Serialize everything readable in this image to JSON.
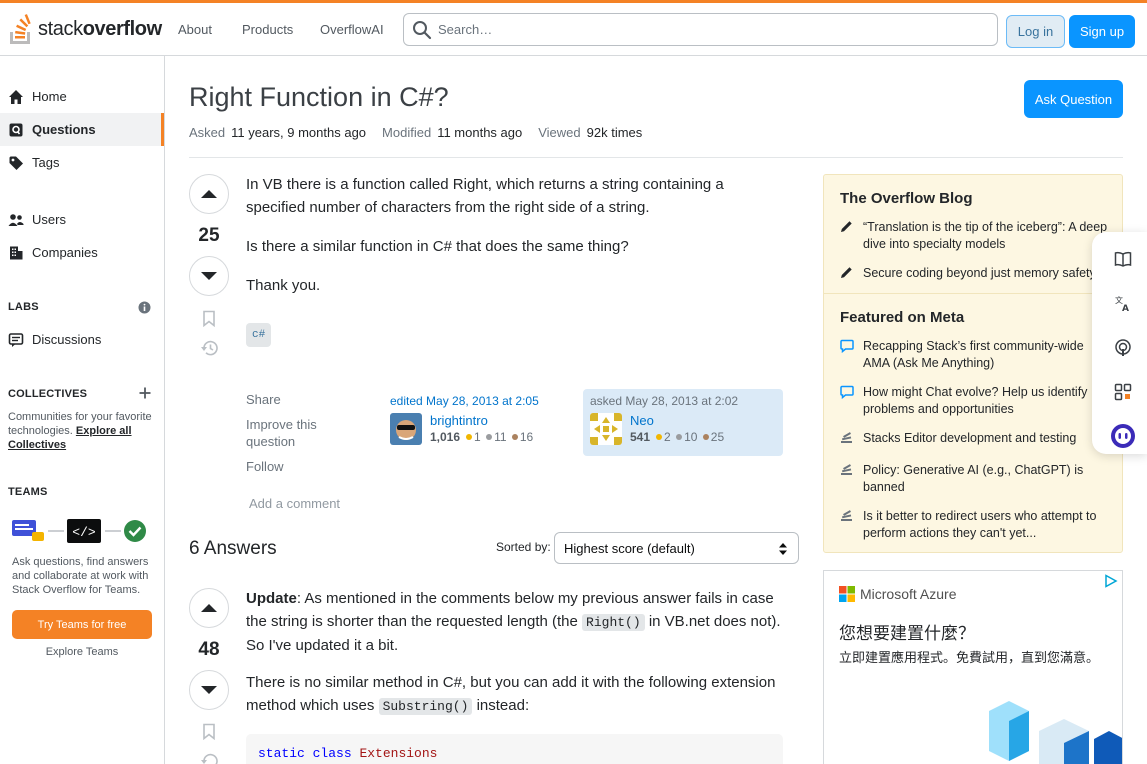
{
  "colors": {
    "accent": "#f48225",
    "primary": "#0a95ff",
    "link": "#0074cc"
  },
  "header": {
    "logo_prefix": "stack",
    "logo_suffix": "overflow",
    "nav": [
      "About",
      "Products",
      "OverflowAI"
    ],
    "search_placeholder": "Search…",
    "login": "Log in",
    "signup": "Sign up"
  },
  "sidebar": {
    "items": [
      {
        "label": "Home",
        "icon": "home-icon"
      },
      {
        "label": "Questions",
        "icon": "questions-icon"
      },
      {
        "label": "Tags",
        "icon": "tag-icon"
      },
      {
        "label": "Users",
        "icon": "users-icon"
      },
      {
        "label": "Companies",
        "icon": "companies-icon"
      },
      {
        "label": "Discussions",
        "icon": "discussions-icon"
      }
    ],
    "labs": "LABS",
    "collectives": "COLLECTIVES",
    "collectives_text": "Communities for your favorite technologies.",
    "collectives_link": "Explore all Collectives",
    "teams": "TEAMS",
    "teams_text": "Ask questions, find answers and collaborate at work with Stack Overflow for Teams.",
    "teams_button": "Try Teams for free",
    "teams_explore": "Explore Teams"
  },
  "question": {
    "title": "Right Function in C#?",
    "asked_label": "Asked",
    "asked_value": "11 years, 9 months ago",
    "modified_label": "Modified",
    "modified_value": "11 months ago",
    "viewed_label": "Viewed",
    "viewed_value": "92k times",
    "ask_button": "Ask Question",
    "score": "25",
    "body": [
      "In VB there is a function called Right, which returns a string containing a specified number of characters from the right side of a string.",
      "Is there a similar function in C# that does the same thing?",
      "Thank you."
    ],
    "tag": "c#",
    "menu": {
      "share": "Share",
      "improve": "Improve this question",
      "follow": "Follow"
    },
    "editor": {
      "when": "edited May 28, 2013 at 2:05",
      "name": "brightintro",
      "rep": "1,016",
      "gold": "1",
      "silver": "11",
      "bronze": "16"
    },
    "owner": {
      "when": "asked May 28, 2013 at 2:02",
      "name": "Neo",
      "rep": "541",
      "gold": "2",
      "silver": "10",
      "bronze": "25"
    },
    "add_comment": "Add a comment"
  },
  "answers": {
    "heading": "6 Answers",
    "sort_label": "Sorted by:",
    "sort_value": "Highest score (default)",
    "first": {
      "score": "48",
      "update_bold": "Update",
      "update_a": ": As mentioned in the comments below my previous answer fails in case the string is shorter than the requested length (the ",
      "update_code": "Right()",
      "update_b": " in VB.net does not). So I've updated it a bit.",
      "p2_a": "There is no similar method in C#, but you can add it with the following extension method which uses ",
      "p2_code": "Substring()",
      "p2_b": " instead:",
      "code_kw1": "static",
      "code_kw2": "class",
      "code_type": "Extensions"
    }
  },
  "blog": {
    "title": "The Overflow Blog",
    "items": [
      "“Translation is the tip of the iceberg”: A deep dive into specialty models",
      "Secure coding beyond just memory safety"
    ],
    "meta_title": "Featured on Meta",
    "meta_items": [
      "Recapping Stack’s first community-wide AMA (Ask Me Anything)",
      "How might Chat evolve? Help us identify problems and opportunities",
      "Stacks Editor development and testing",
      "Policy: Generative AI (e.g., ChatGPT) is banned",
      "Is it better to redirect users who attempt to perform actions they can't yet..."
    ]
  },
  "ad": {
    "brand": "Microsoft Azure",
    "headline": "您想要建置什麼？",
    "text": "立即建置應用程式。免費試用，直到您滿意。"
  }
}
